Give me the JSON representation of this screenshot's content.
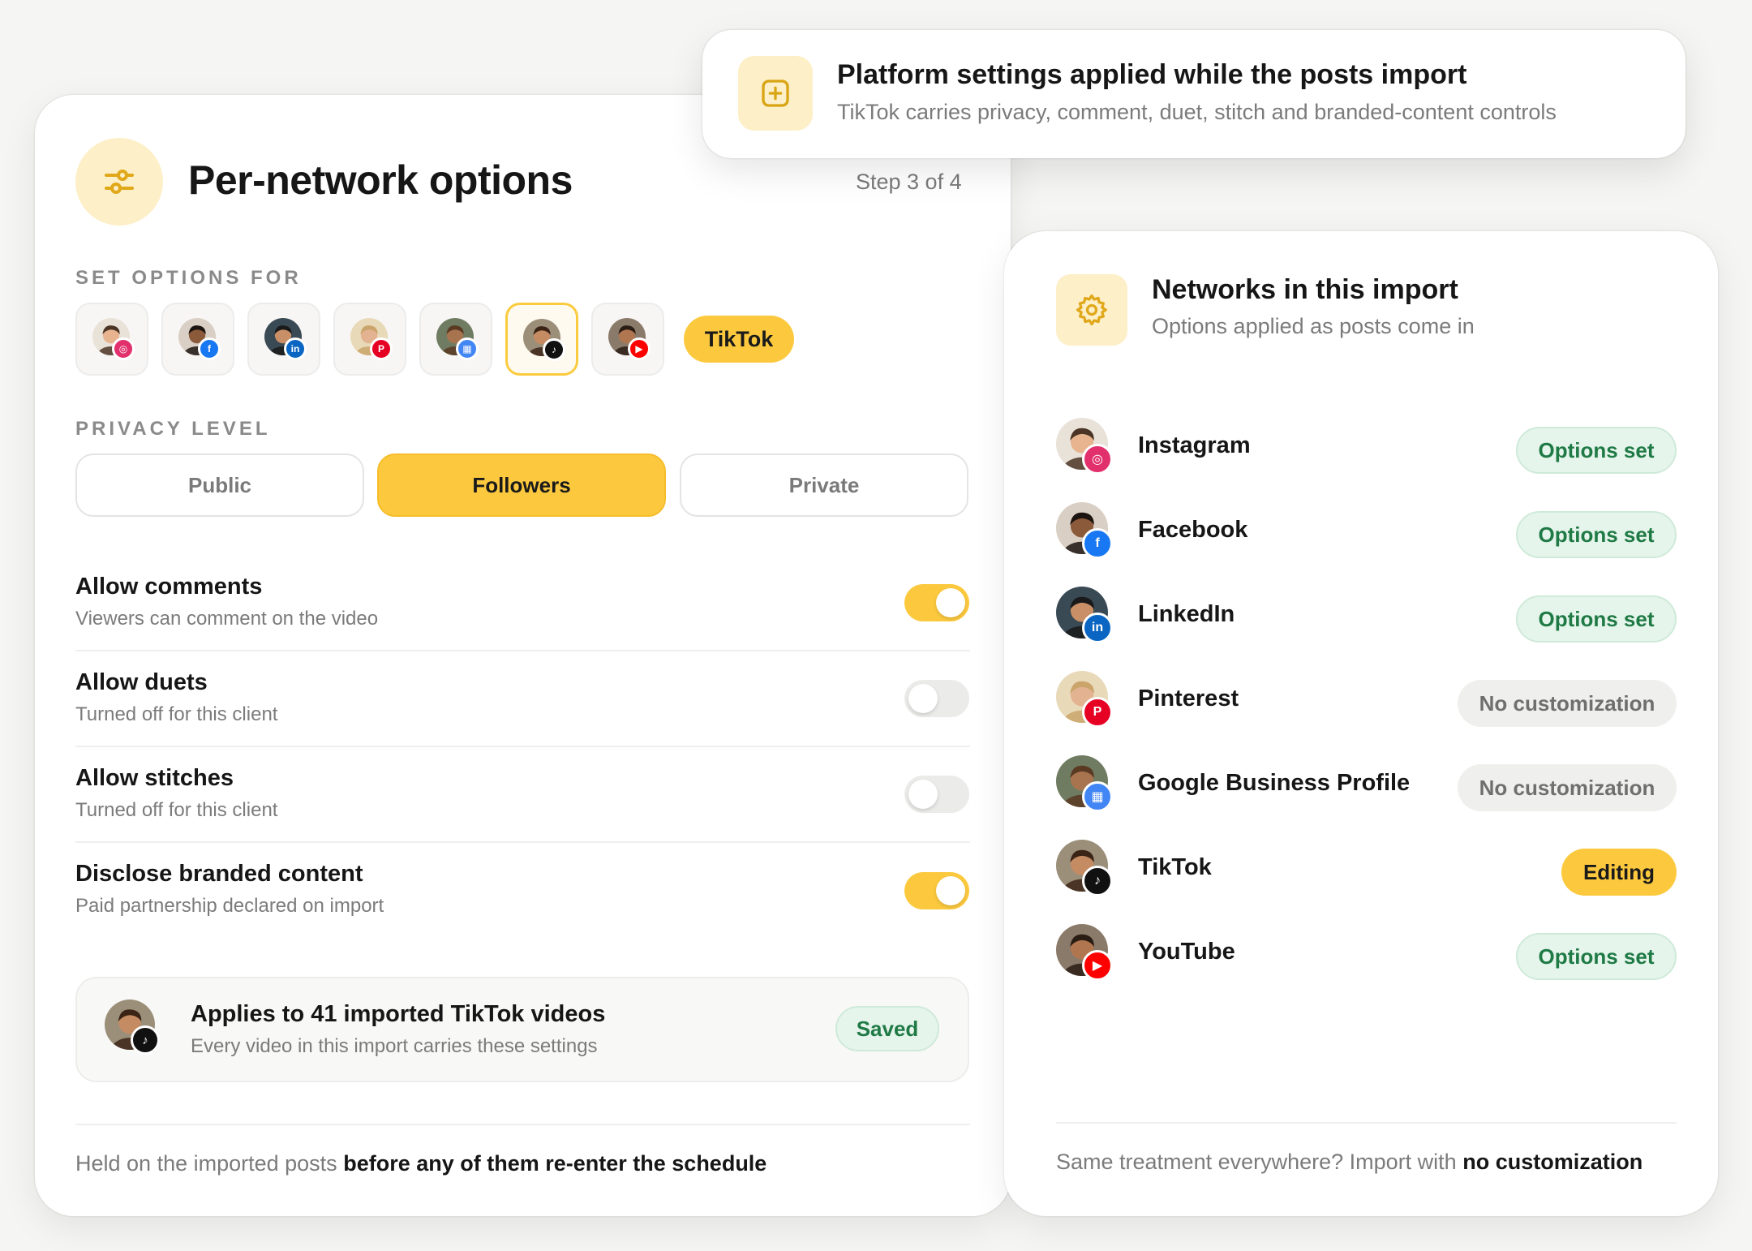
{
  "top_banner": {
    "title": "Platform settings applied while the posts import",
    "subtitle": "TikTok carries privacy, comment, duet, stitch and branded-content controls",
    "icon": "plus-square-icon"
  },
  "left_panel": {
    "title": "Per-network options",
    "step": "Step 3 of 4",
    "icon": "sliders-icon",
    "set_options_label": "SET OPTIONS FOR",
    "selected_network": "TikTok",
    "networks": [
      {
        "name": "Instagram",
        "badge_color": "#e1306c",
        "badge_icon": "instagram-icon"
      },
      {
        "name": "Facebook",
        "badge_color": "#1877f2",
        "badge_icon": "facebook-icon"
      },
      {
        "name": "LinkedIn",
        "badge_color": "#0a66c2",
        "badge_icon": "linkedin-icon"
      },
      {
        "name": "Pinterest",
        "badge_color": "#e60023",
        "badge_icon": "pinterest-icon"
      },
      {
        "name": "Google Business Profile",
        "badge_color": "#4285f4",
        "badge_icon": "google-business-icon"
      },
      {
        "name": "TikTok",
        "badge_color": "#111111",
        "badge_icon": "tiktok-icon"
      },
      {
        "name": "YouTube",
        "badge_color": "#ff0000",
        "badge_icon": "youtube-icon"
      }
    ],
    "privacy_label": "PRIVACY LEVEL",
    "privacy_options": [
      "Public",
      "Followers",
      "Private"
    ],
    "privacy_selected": "Followers",
    "toggles": [
      {
        "title": "Allow comments",
        "subtitle": "Viewers can comment on the video",
        "on": true
      },
      {
        "title": "Allow duets",
        "subtitle": "Turned off for this client",
        "on": false
      },
      {
        "title": "Allow stitches",
        "subtitle": "Turned off for this client",
        "on": false
      },
      {
        "title": "Disclose branded content",
        "subtitle": "Paid partnership declared on import",
        "on": true
      }
    ],
    "summary": {
      "title": "Applies to 41 imported TikTok videos",
      "subtitle": "Every video in this import carries these settings",
      "status": "Saved"
    },
    "footer_prefix": "Held on the imported posts",
    "footer_bold": "before any of them re-enter the schedule"
  },
  "right_panel": {
    "title": "Networks in this import",
    "subtitle": "Options applied as posts come in",
    "icon": "gear-icon",
    "networks": [
      {
        "name": "Instagram",
        "status": "Options set",
        "state": "set"
      },
      {
        "name": "Facebook",
        "status": "Options set",
        "state": "set"
      },
      {
        "name": "LinkedIn",
        "status": "Options set",
        "state": "set"
      },
      {
        "name": "Pinterest",
        "status": "No customization",
        "state": "none"
      },
      {
        "name": "Google Business Profile",
        "status": "No customization",
        "state": "none"
      },
      {
        "name": "TikTok",
        "status": "Editing",
        "state": "editing"
      },
      {
        "name": "YouTube",
        "status": "Options set",
        "state": "set"
      }
    ],
    "footer_prefix": "Same treatment everywhere? Import with",
    "footer_bold": "no customization"
  },
  "colors": {
    "accent": "#fcc93e",
    "accent_soft": "#fdefc7",
    "success_bg": "#e6f5ec",
    "success_text": "#1f7a45"
  }
}
